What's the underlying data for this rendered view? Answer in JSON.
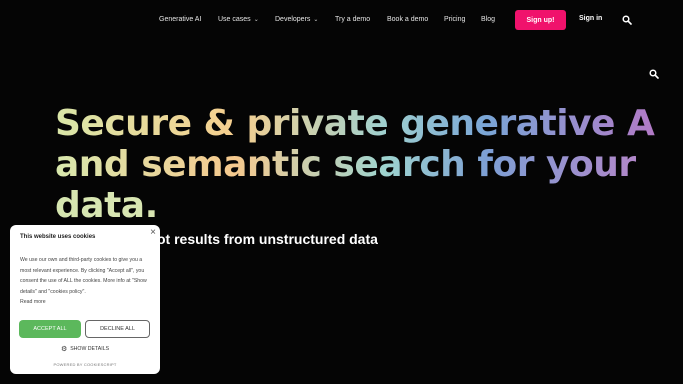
{
  "nav": {
    "items": [
      {
        "label": "Generative AI",
        "chevron": false
      },
      {
        "label": "Use cases",
        "chevron": true
      },
      {
        "label": "Developers",
        "chevron": true
      },
      {
        "label": "Try a demo",
        "chevron": false
      },
      {
        "label": "Book a demo",
        "chevron": false
      },
      {
        "label": "Pricing",
        "chevron": false
      },
      {
        "label": "Blog",
        "chevron": false
      }
    ],
    "signup_label": "Sign up!",
    "signin_label": "Sign in",
    "signup_color": "#f0126c"
  },
  "hero": {
    "line1": "Secure & private generative AI",
    "line2": "and semantic search for your",
    "line3": "data."
  },
  "subtitle": "ot results from unstructured data",
  "cookie_banner": {
    "title": "This website uses cookies",
    "close_glyph": "×",
    "body": "We use our own and third-party cookies to give you a most relevant experience. By clicking \"Accept all\", you consent the use of ALL the cookies. More info at \"Show details\" and \"cookies policy\".",
    "read_more": "Read more",
    "accept_label": "ACCEPT ALL",
    "decline_label": "DECLINE ALL",
    "show_details_label": "SHOW DETAILS",
    "powered_by": "POWERED BY COOKIESCRIPT",
    "accept_color": "#5cb85c"
  },
  "icons": {
    "nav_search": "search-icon",
    "page_search": "search-icon",
    "settings": "gear-icon"
  }
}
